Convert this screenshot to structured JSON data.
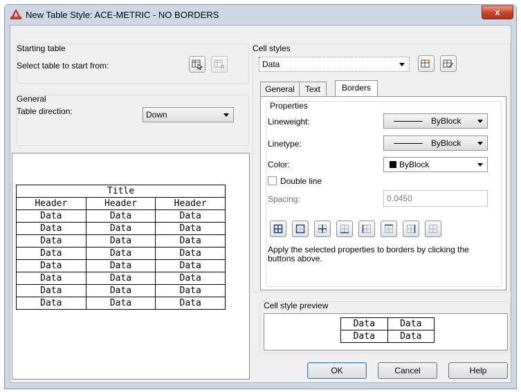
{
  "window": {
    "title": "New Table Style: ACE-METRIC - NO BORDERS",
    "close_glyph": "x"
  },
  "starting_table": {
    "legend": "Starting table",
    "label": "Select table to start from:"
  },
  "general": {
    "legend": "General",
    "direction_label": "Table direction:",
    "direction_value": "Down"
  },
  "preview_table": {
    "title": "Title",
    "headers": [
      "Header",
      "Header",
      "Header"
    ],
    "rows": [
      [
        "Data",
        "Data",
        "Data"
      ],
      [
        "Data",
        "Data",
        "Data"
      ],
      [
        "Data",
        "Data",
        "Data"
      ],
      [
        "Data",
        "Data",
        "Data"
      ],
      [
        "Data",
        "Data",
        "Data"
      ],
      [
        "Data",
        "Data",
        "Data"
      ],
      [
        "Data",
        "Data",
        "Data"
      ],
      [
        "Data",
        "Data",
        "Data"
      ]
    ]
  },
  "cell_styles": {
    "legend": "Cell styles",
    "selected": "Data",
    "tabs": [
      "General",
      "Text",
      "Borders"
    ],
    "active_tab": "Borders",
    "properties_legend": "Properties",
    "lineweight_label": "Lineweight:",
    "lineweight_value": "ByBlock",
    "linetype_label": "Linetype:",
    "linetype_value": "ByBlock",
    "color_label": "Color:",
    "color_value": "ByBlock",
    "double_line_label": "Double line",
    "spacing_label": "Spacing:",
    "spacing_value": "0.0450",
    "help_text": "Apply the selected properties to borders by clicking the buttons above."
  },
  "cell_style_preview": {
    "legend": "Cell style preview",
    "rows": [
      [
        "Data",
        "Data"
      ],
      [
        "Data",
        "Data"
      ]
    ]
  },
  "buttons": {
    "ok": "OK",
    "cancel": "Cancel",
    "help": "Help"
  }
}
